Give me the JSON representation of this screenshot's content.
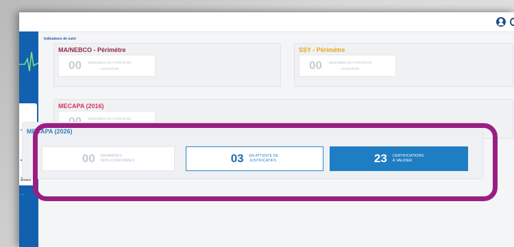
{
  "colors": {
    "sidebar": "#1260b0",
    "highlight": "#9b1e82",
    "accent": "#1f7ec3",
    "ma_nebco_title": "#8e2a4a",
    "ssy_title": "#e8a317",
    "mecapa_2016_title": "#d6335c",
    "mecapa_2026_title": "#2f7fc0"
  },
  "header": {
    "user_icon": "user-circle-icon"
  },
  "sidebar": {
    "chart_icon": "pulse-chart-icon",
    "items": [
      {
        "text": "2026"
      }
    ]
  },
  "main": {
    "section_title": "Indicateurs de suivi",
    "cards": [
      {
        "title": "MA/NEBCO - Périmètre",
        "value": "00",
        "label": "DEMANDES EN ATTENTE DE VALIDATION"
      },
      {
        "title": "SSY - Périmètre",
        "value": "00",
        "label": "DEMANDES EN ATTENTE DE VALIDATION"
      },
      {
        "title": "MECAPA (2016)",
        "value": "00",
        "label": "DEMANDES EN ATTENTE DE VALIDATION"
      }
    ],
    "mecapa_2026": {
      "title": "MECAPA (2026)",
      "tiles": [
        {
          "value": "00",
          "label_line1": "DEMANDES",
          "label_line2": "NON CONFORMES"
        },
        {
          "value": "03",
          "label_line1": "EN ATTENTE DE",
          "label_line2": "JUSTIFICATIFS"
        },
        {
          "value": "23",
          "label_line1": "CERTIFICATIONS",
          "label_line2": "À VALIDER"
        }
      ]
    }
  }
}
